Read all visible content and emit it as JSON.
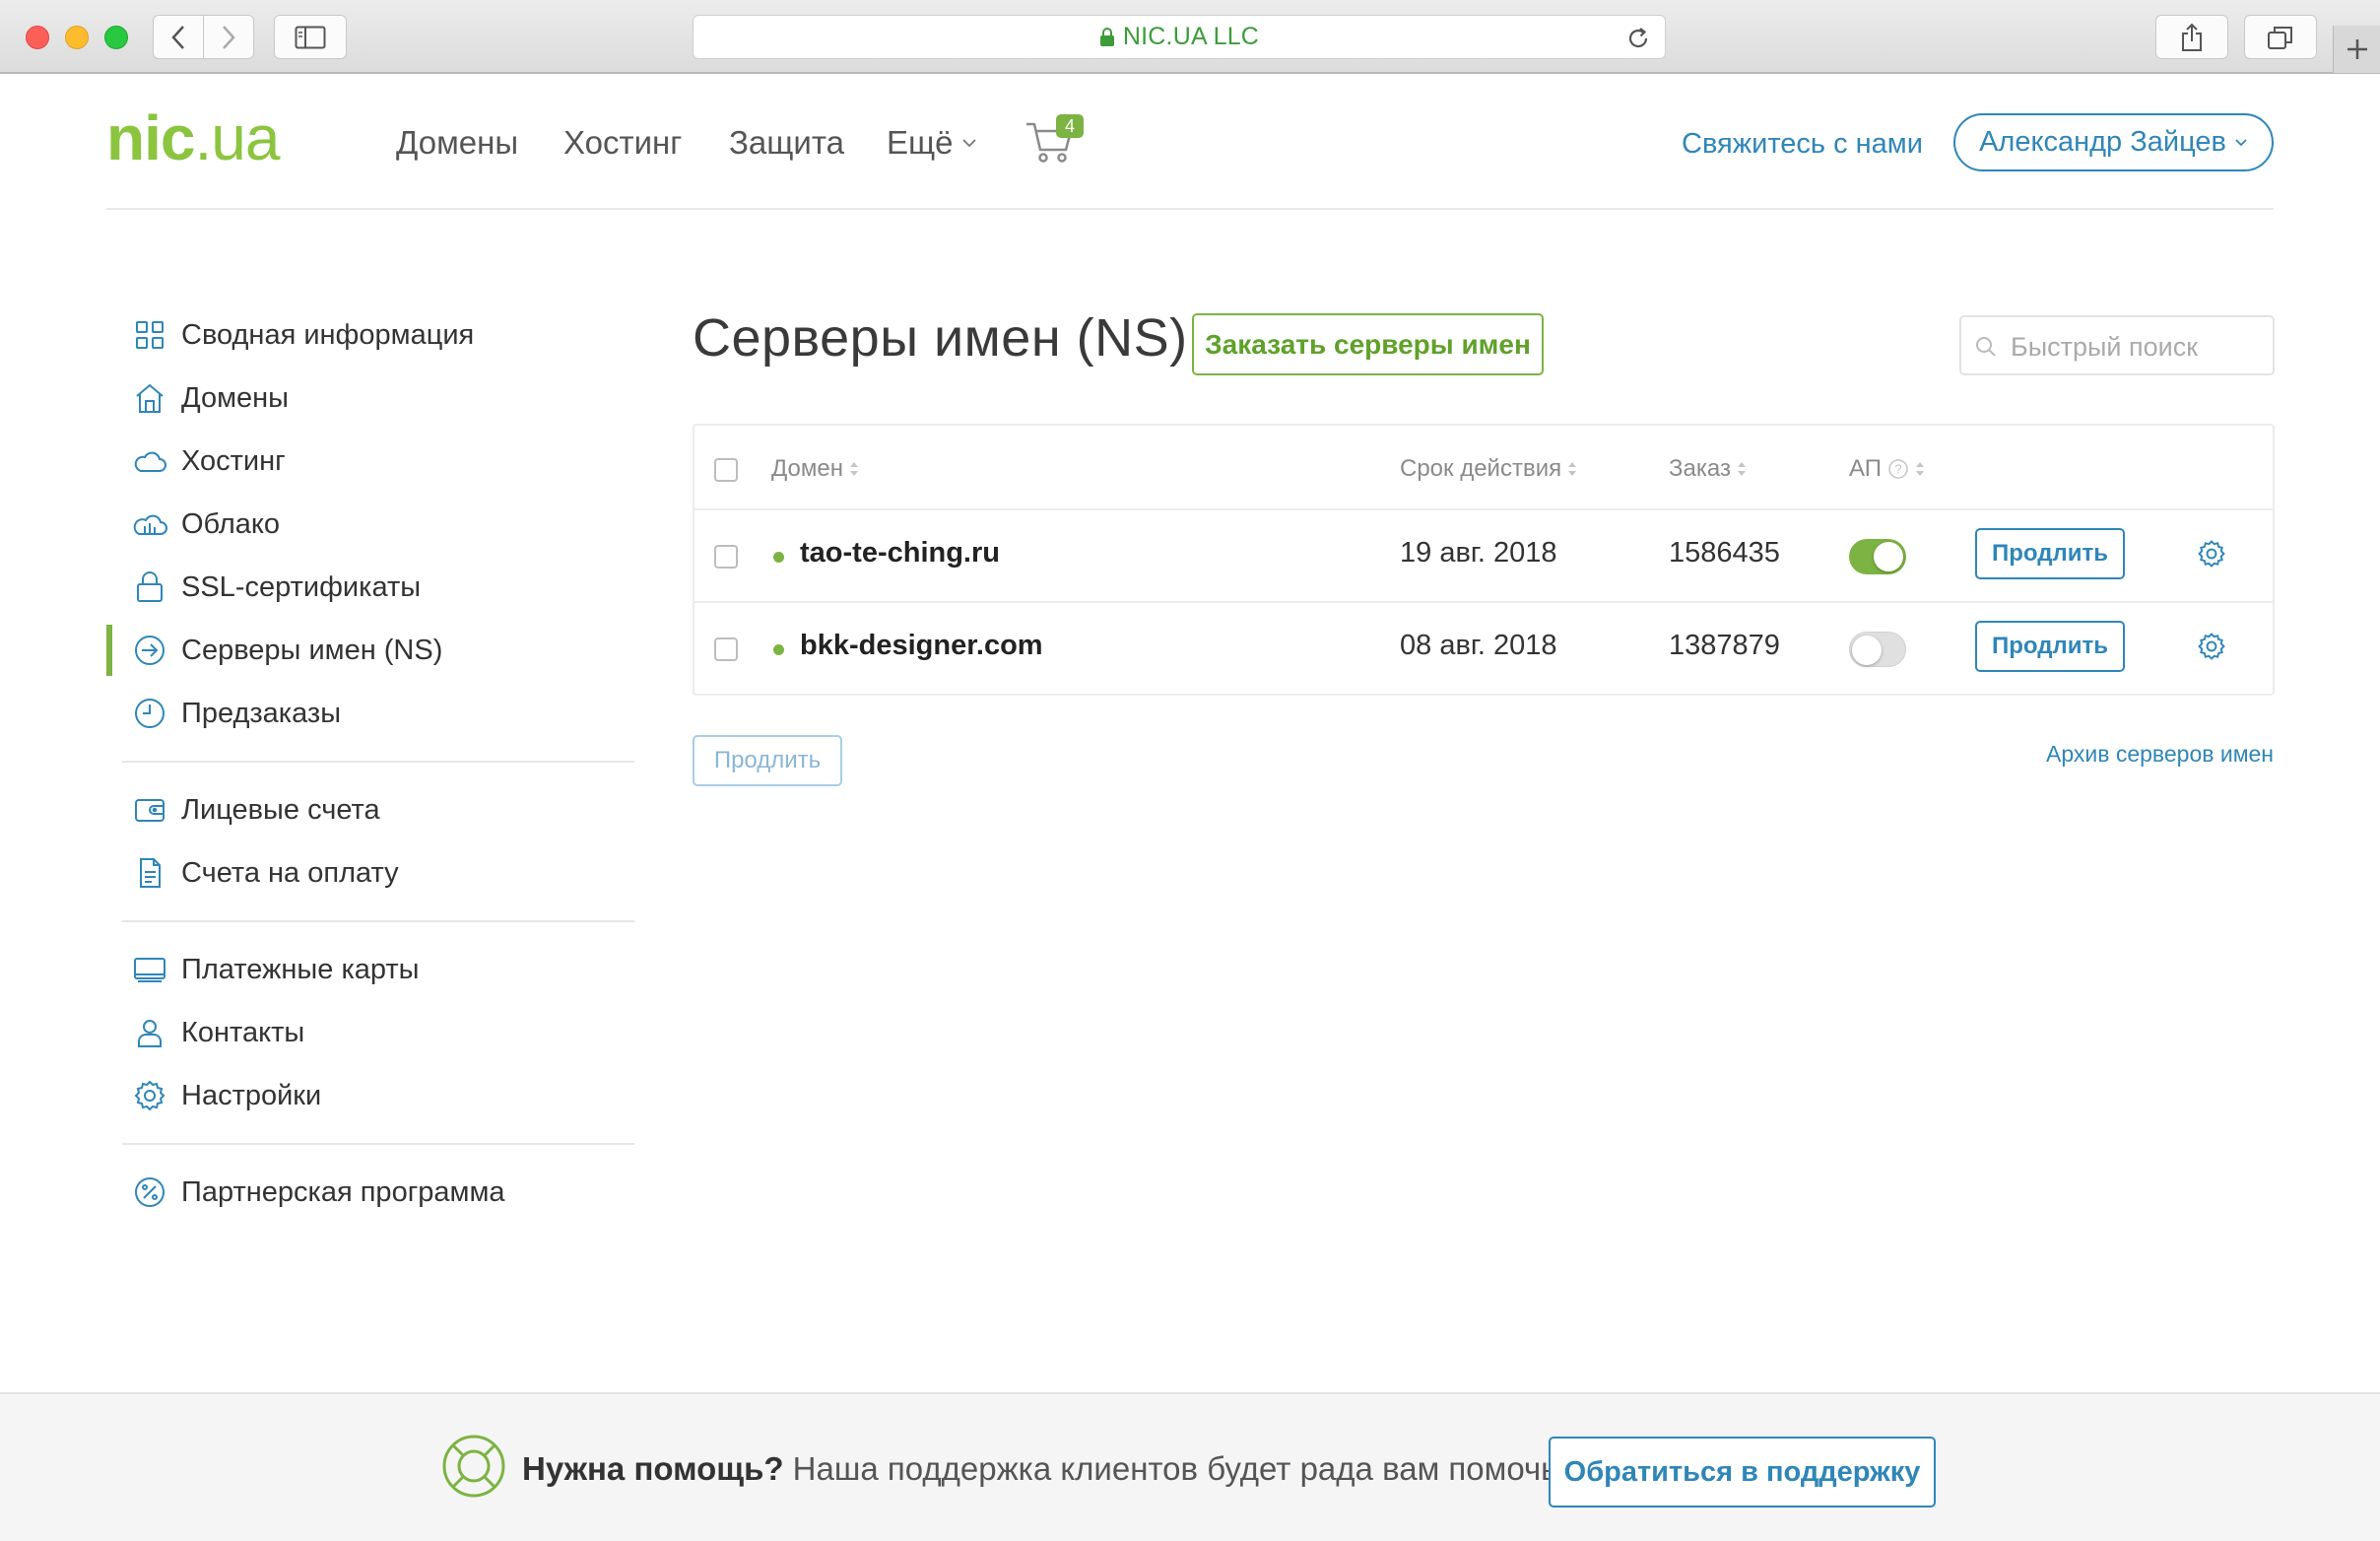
{
  "browser": {
    "address": "NIC.UA LLC"
  },
  "header": {
    "logo_main": "nic",
    "logo_tld": ".ua",
    "nav": {
      "domains": "Домены",
      "hosting": "Хостинг",
      "protection": "Защита",
      "more": "Ещё"
    },
    "cart_count": "4",
    "contact": "Свяжитесь с нами",
    "user": "Александр Зайцев"
  },
  "sidebar": {
    "items": [
      {
        "label": "Сводная информация",
        "icon": "dashboard-icon"
      },
      {
        "label": "Домены",
        "icon": "home-icon"
      },
      {
        "label": "Хостинг",
        "icon": "cloud-icon"
      },
      {
        "label": "Облако",
        "icon": "cloud-server-icon"
      },
      {
        "label": "SSL-сертификаты",
        "icon": "lock-icon"
      },
      {
        "label": "Серверы имен (NS)",
        "icon": "arrow-circle-icon",
        "active": true
      },
      {
        "label": "Предзаказы",
        "icon": "clock-icon"
      },
      {
        "label": "Лицевые счета",
        "icon": "wallet-icon"
      },
      {
        "label": "Счета на оплату",
        "icon": "document-icon"
      },
      {
        "label": "Платежные карты",
        "icon": "card-icon"
      },
      {
        "label": "Контакты",
        "icon": "user-icon"
      },
      {
        "label": "Настройки",
        "icon": "gear-icon"
      },
      {
        "label": "Партнерская программа",
        "icon": "percent-icon"
      }
    ]
  },
  "main": {
    "title": "Серверы имен (NS)",
    "order_button": "Заказать серверы имен",
    "search_placeholder": "Быстрый поиск",
    "table": {
      "columns": {
        "domain": "Домен",
        "expiry": "Срок действия",
        "order": "Заказ",
        "autorenew": "АП"
      },
      "rows": [
        {
          "domain": "tao-te-ching.ru",
          "expiry": "19 авг. 2018",
          "order": "1586435",
          "autorenew": true,
          "renew": "Продлить"
        },
        {
          "domain": "bkk-designer.com",
          "expiry": "08 авг. 2018",
          "order": "1387879",
          "autorenew": false,
          "renew": "Продлить"
        }
      ]
    },
    "bulk_renew": "Продлить",
    "archive_link": "Архив серверов имен"
  },
  "footer": {
    "help_bold": "Нужна помощь?",
    "help_text": " Наша поддержка клиентов будет рада вам помочь.",
    "support_button": "Обратиться в поддержку"
  },
  "colors": {
    "brand_green": "#7cb342",
    "link_blue": "#2f86b8"
  }
}
